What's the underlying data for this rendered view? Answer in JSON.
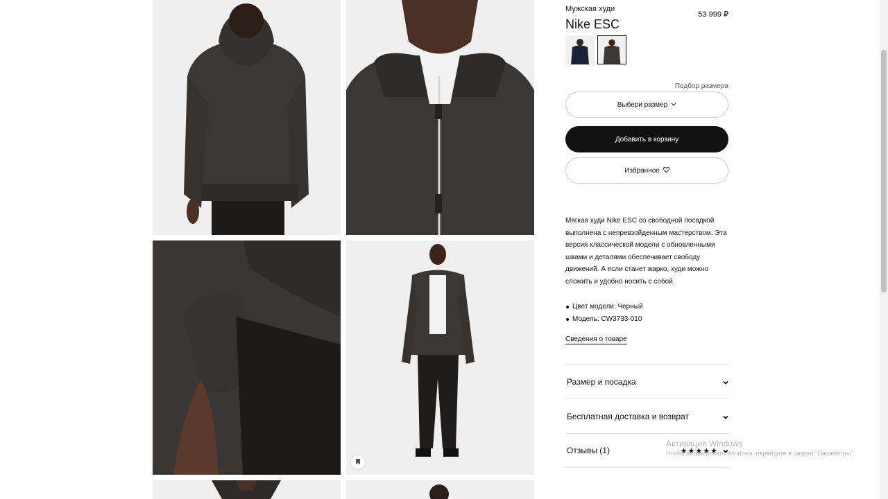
{
  "product": {
    "subtitle": "Мужская худи",
    "title": "Nike ESC",
    "price": "53 999 ₽",
    "size_guide": "Подбор размера",
    "select_size": "Выбери размер",
    "add_to_cart": "Добавить в корзину",
    "favorite": "Избранное",
    "description": "Мягкая худи Nike ESC со свободной посадкой выполнена с непревзойденным мастерством. Эта версия классической модели с обновленными швами и деталями обеспечивает свободу движений. А если станет жарко, худи можно сложить и удобно носить с собой.",
    "bullets": [
      "Цвет модели: Черный",
      "Модель: CW3733-010"
    ],
    "details_link": "Сведения о товаре"
  },
  "accordion": [
    {
      "label": "Размер и посадка"
    },
    {
      "label": "Бесплатная доставка и возврат"
    },
    {
      "label": "Отзывы (1)",
      "stars": "★★★★★"
    }
  ],
  "watermark": {
    "title": "Активация Windows",
    "text": "Чтобы активировать Windows, перейдите в раздел \"Параметры\"."
  },
  "colors": {
    "primary": "#111111",
    "border": "#cccccc",
    "hoodie": "#3b3734"
  },
  "icons": [
    "chevron-down-icon",
    "heart-icon",
    "bookmark-icon"
  ]
}
